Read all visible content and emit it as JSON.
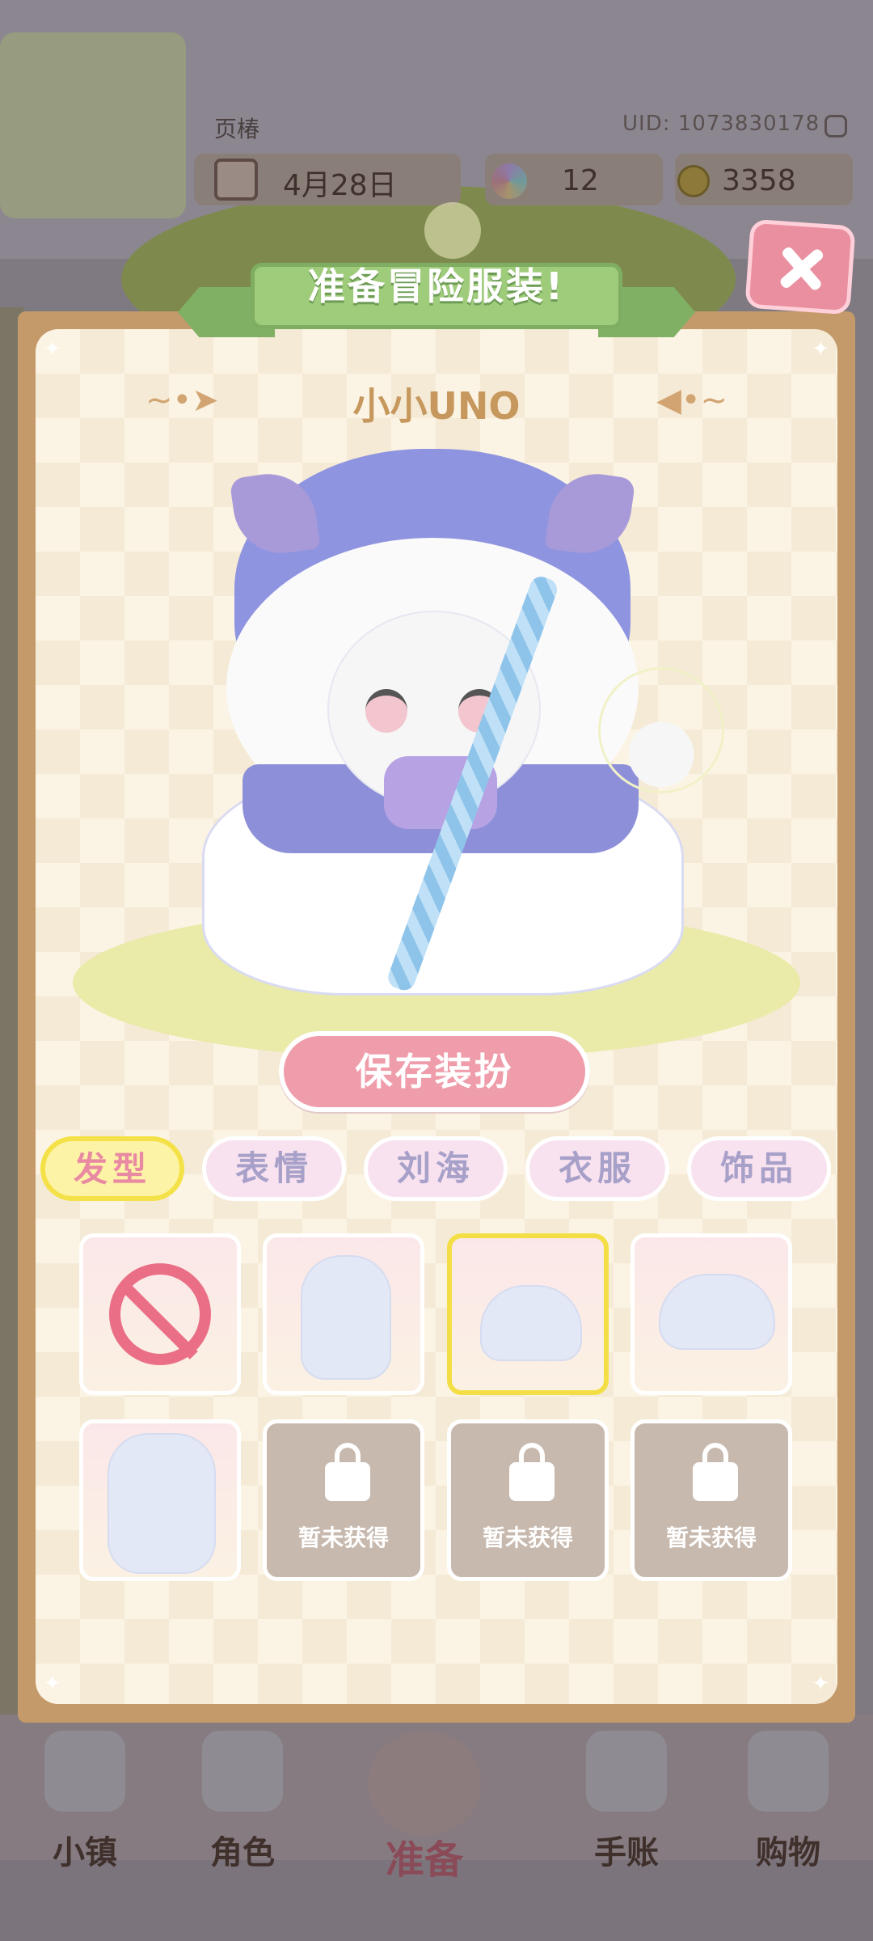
{
  "hud": {
    "nickname": "页椿",
    "uid": "UID: 1073830178",
    "date": "4月28日",
    "gems": "12",
    "coins": "3358"
  },
  "dialog": {
    "banner_title": "准备冒险服装!",
    "character_name": "小小UNO",
    "save_button": "保存装扮",
    "tabs": [
      {
        "label": "发型",
        "active": true
      },
      {
        "label": "表情",
        "active": false
      },
      {
        "label": "刘海",
        "active": false
      },
      {
        "label": "衣服",
        "active": false
      },
      {
        "label": "饰品",
        "active": false
      }
    ],
    "items": [
      {
        "kind": "none-icon"
      },
      {
        "kind": "long-hair"
      },
      {
        "kind": "short-hair",
        "selected": true
      },
      {
        "kind": "bob-hair"
      },
      {
        "kind": "twin-hair"
      },
      {
        "kind": "locked",
        "label": "暂未获得"
      },
      {
        "kind": "locked",
        "label": "暂未获得"
      },
      {
        "kind": "locked",
        "label": "暂未获得"
      }
    ]
  },
  "nav": [
    {
      "label": "小镇"
    },
    {
      "label": "角色"
    },
    {
      "label": "准备"
    },
    {
      "label": "手账"
    },
    {
      "label": "购物"
    }
  ]
}
